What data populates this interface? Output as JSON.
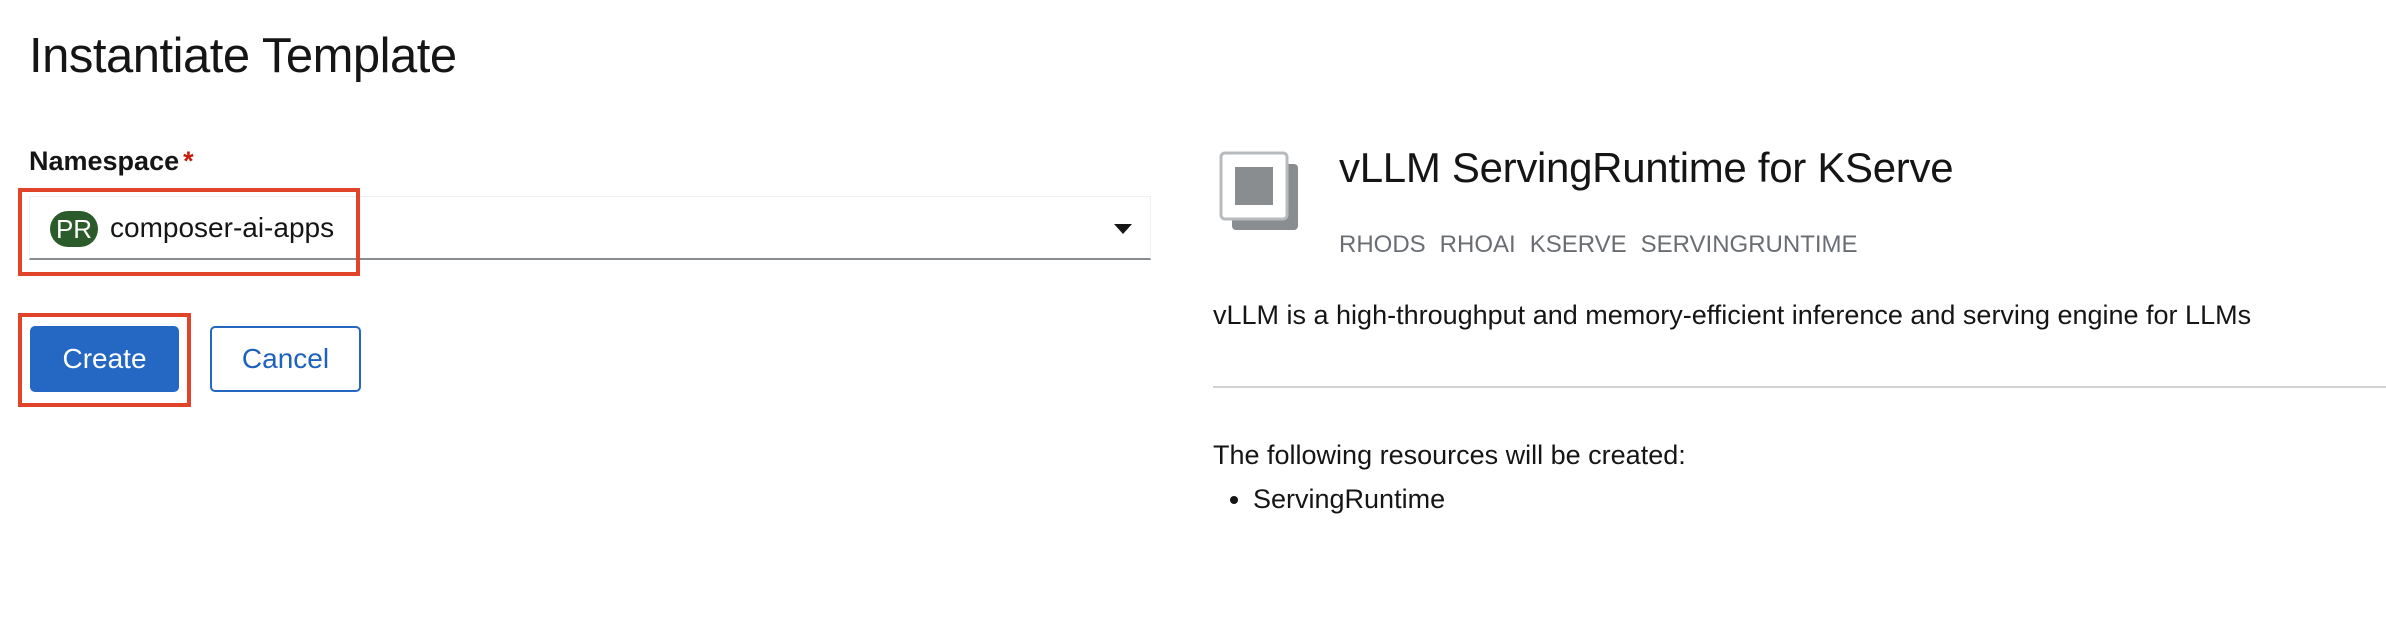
{
  "page": {
    "title": "Instantiate Template"
  },
  "namespace": {
    "label": "Namespace",
    "required_mark": "*",
    "badge": "PR",
    "value": "composer-ai-apps",
    "badge_color": "#2b5a2b"
  },
  "actions": {
    "create_label": "Create",
    "cancel_label": "Cancel",
    "primary_color": "#2468c4"
  },
  "template": {
    "icon": "template-icon",
    "title": "vLLM ServingRuntime for KServe",
    "tags": [
      "RHODS",
      "RHOAI",
      "KSERVE",
      "SERVINGRUNTIME"
    ],
    "description": "vLLM is a high-throughput and memory-efficient inference and serving engine for LLMs",
    "resources_intro": "The following resources will be created:",
    "resources": [
      "ServingRuntime"
    ]
  },
  "highlight_color": "#e1442b"
}
